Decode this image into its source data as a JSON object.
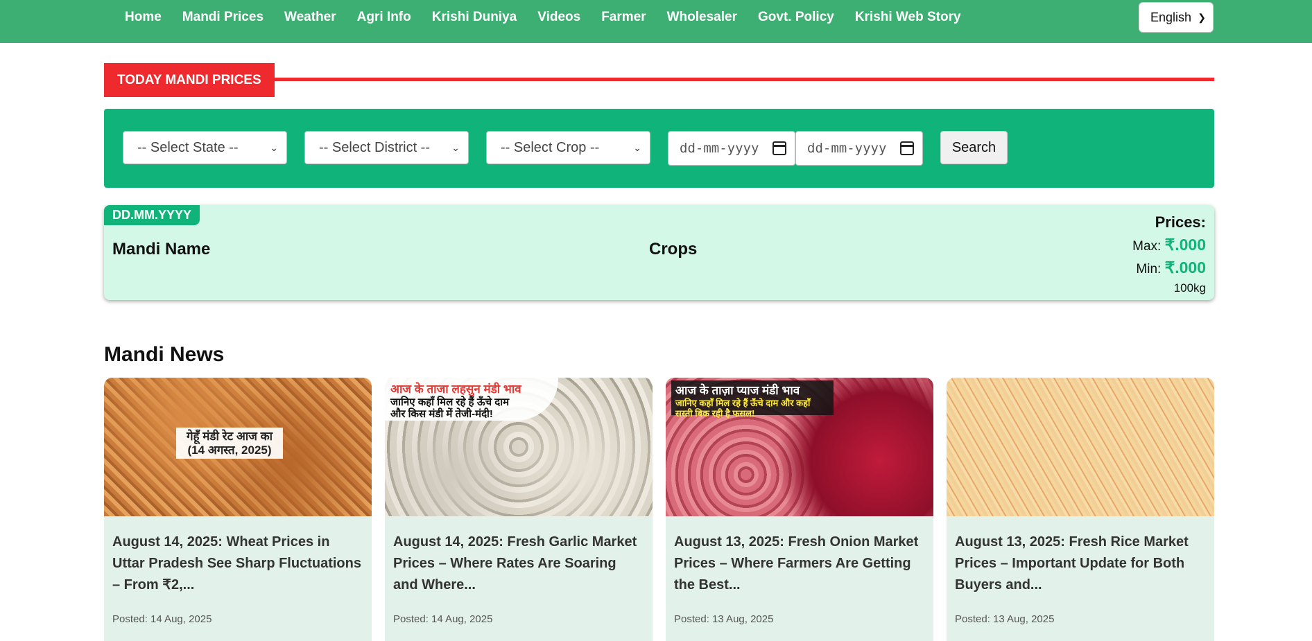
{
  "nav": {
    "links": [
      "Home",
      "Mandi Prices",
      "Weather",
      "Agri Info",
      "Krishi Duniya",
      "Videos",
      "Farmer",
      "Wholesaler",
      "Govt. Policy",
      "Krishi Web Story"
    ],
    "language": "English"
  },
  "section": {
    "label": "TODAY MANDI PRICES"
  },
  "filters": {
    "state_placeholder": "-- Select State --",
    "district_placeholder": "-- Select District --",
    "crop_placeholder": "-- Select Crop --",
    "from_date_placeholder": "dd-mm-yyyy",
    "to_date_placeholder": "dd-mm-yyyy",
    "search_label": "Search"
  },
  "price_card": {
    "date_badge": "DD.MM.YYYY",
    "mandi_header": "Mandi Name",
    "crops_header": "Crops",
    "prices_title": "Prices:",
    "max_label": "Max:",
    "max_value": "₹.000",
    "min_label": "Min:",
    "min_value": "₹.000",
    "unit": "100kg"
  },
  "news": {
    "title": "Mandi News",
    "cards": [
      {
        "image_text": [
          "गेहूँ मंडी रेट आज का",
          "(14 अगस्त, 2025)"
        ],
        "headline": "August 14, 2025: Wheat Prices in Uttar Pradesh See Sharp Fluctuations – From ₹2,...",
        "posted": "Posted: 14 Aug, 2025"
      },
      {
        "image_text": [
          "आज के ताजा लहसुन मंडी भाव",
          "जानिए कहाँ मिल रहे हैं ऊँचे दाम",
          "और किस मंडी में तेजी-मंदी!"
        ],
        "headline": "August 14, 2025: Fresh Garlic Market Prices – Where Rates Are Soaring and Where...",
        "posted": "Posted: 14 Aug, 2025"
      },
      {
        "image_text": [
          "आज के ताज़ा प्याज मंडी भाव",
          "जानिए कहाँ मिल रहे हैं ऊँचे दाम और कहाँ",
          "सस्ती बिक रही है फसल!"
        ],
        "headline": "August 13, 2025: Fresh Onion Market Prices – Where Farmers Are Getting the Best...",
        "posted": "Posted: 13 Aug, 2025"
      },
      {
        "image_text": [],
        "headline": "August 13, 2025: Fresh Rice Market Prices – Important Update for Both Buyers and...",
        "posted": "Posted: 13 Aug, 2025"
      }
    ]
  },
  "colors": {
    "nav_green": "#3daf72",
    "filter_green": "#10b47a",
    "accent_red": "#ee2a2e",
    "card_mint": "#d3f8e7",
    "news_card_bg": "#e2f2ea"
  }
}
